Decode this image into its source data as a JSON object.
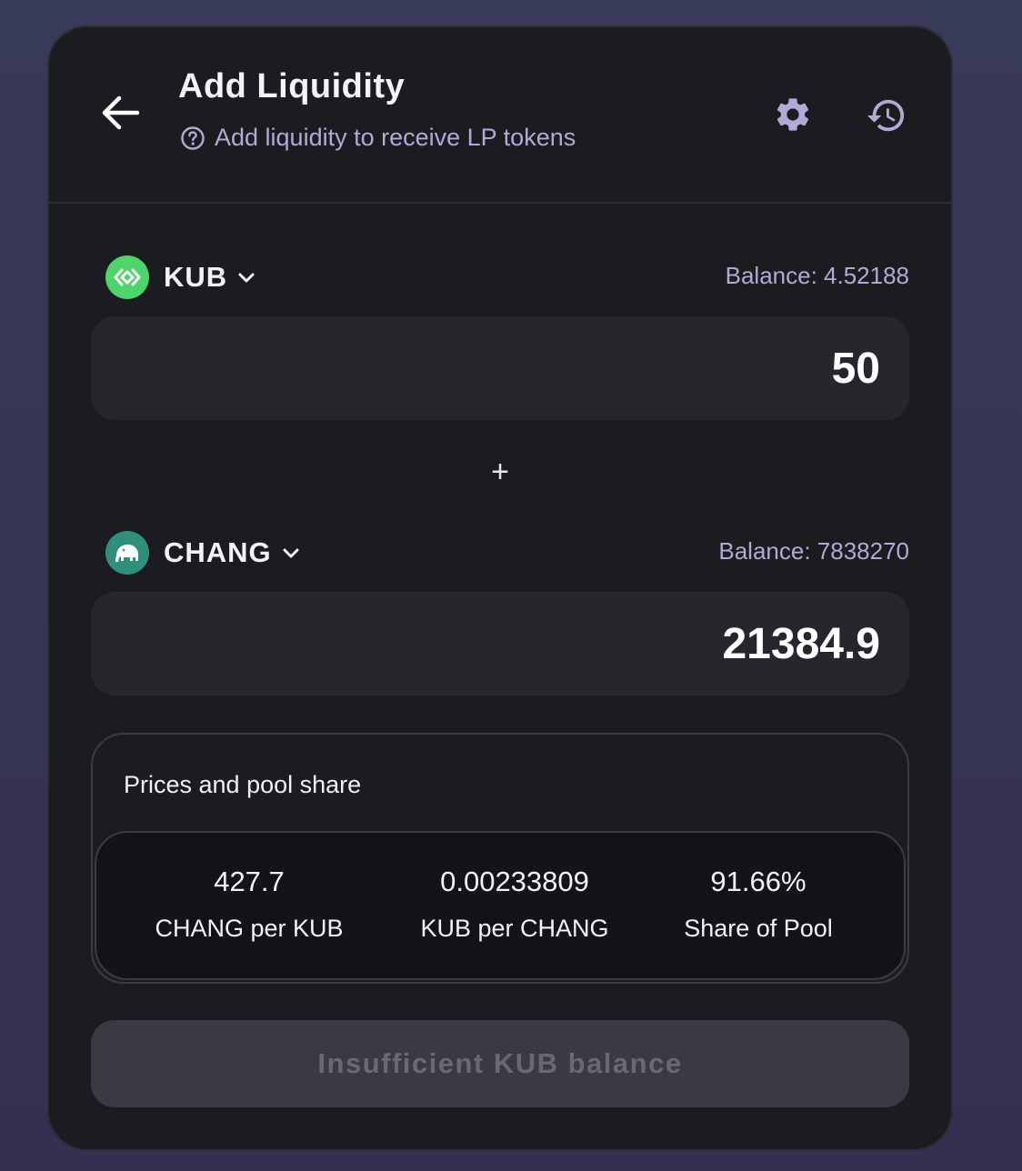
{
  "header": {
    "title": "Add Liquidity",
    "subtitle": "Add liquidity to receive LP tokens"
  },
  "token_a": {
    "symbol": "KUB",
    "balance_label": "Balance: 4.52188",
    "amount": "50",
    "logo_color": "#4fd36b",
    "icon": "kub-logo-icon"
  },
  "token_b": {
    "symbol": "CHANG",
    "balance_label": "Balance: 7838270",
    "amount": "21384.9",
    "logo_color": "#2f8f7a",
    "icon": "elephant-logo-icon"
  },
  "plus": "+",
  "prices": {
    "title": "Prices and pool share",
    "stats": [
      {
        "value": "427.7",
        "label": "CHANG per KUB"
      },
      {
        "value": "0.00233809",
        "label": "KUB per CHANG"
      },
      {
        "value": "91.66%",
        "label": "Share of Pool"
      }
    ]
  },
  "submit": {
    "label": "Insufficient KUB balance",
    "disabled": true
  },
  "colors": {
    "background": "#383a5a",
    "card": "#1b1c20",
    "input": "#26272d",
    "accent_text": "#b4a9d6",
    "disabled_button": "#3b3a42"
  }
}
